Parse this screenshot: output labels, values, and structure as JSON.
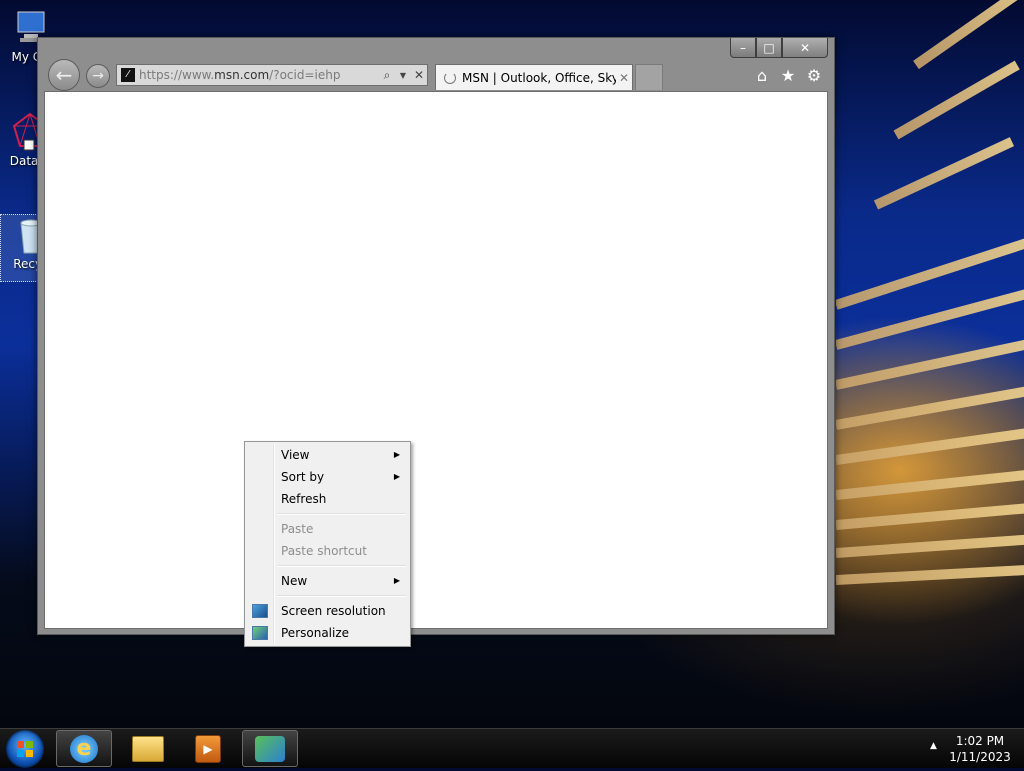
{
  "desktop": {
    "icons": [
      {
        "label": "My Co"
      },
      {
        "label": "DataW"
      },
      {
        "label": "Recyc"
      }
    ]
  },
  "browser": {
    "caption": {
      "minimize": "–",
      "maximize": "□",
      "close": "✕"
    },
    "address": {
      "prefix": "https://www.",
      "domain": "msn.com",
      "suffix": "/?ocid=iehp",
      "favicon": "msn-logo"
    },
    "tab": {
      "title": "MSN | Outlook, Office, Sky..."
    },
    "tools": {
      "home": "⌂",
      "favorites": "★",
      "settings": "⚙"
    }
  },
  "context_menu": {
    "items": [
      {
        "label": "View",
        "has_submenu": true,
        "enabled": true
      },
      {
        "label": "Sort by",
        "has_submenu": true,
        "enabled": true
      },
      {
        "label": "Refresh",
        "has_submenu": false,
        "enabled": true
      },
      {
        "label": "Paste",
        "has_submenu": false,
        "enabled": false
      },
      {
        "label": "Paste shortcut",
        "has_submenu": false,
        "enabled": false
      },
      {
        "label": "New",
        "has_submenu": true,
        "enabled": true
      },
      {
        "label": "Screen resolution",
        "has_submenu": false,
        "enabled": true,
        "icon": "screen-resolution-icon"
      },
      {
        "label": "Personalize",
        "has_submenu": false,
        "enabled": true,
        "icon": "personalize-icon"
      }
    ]
  },
  "taskbar": {
    "clock_time": "1:02 PM",
    "clock_date": "1/11/2023"
  }
}
